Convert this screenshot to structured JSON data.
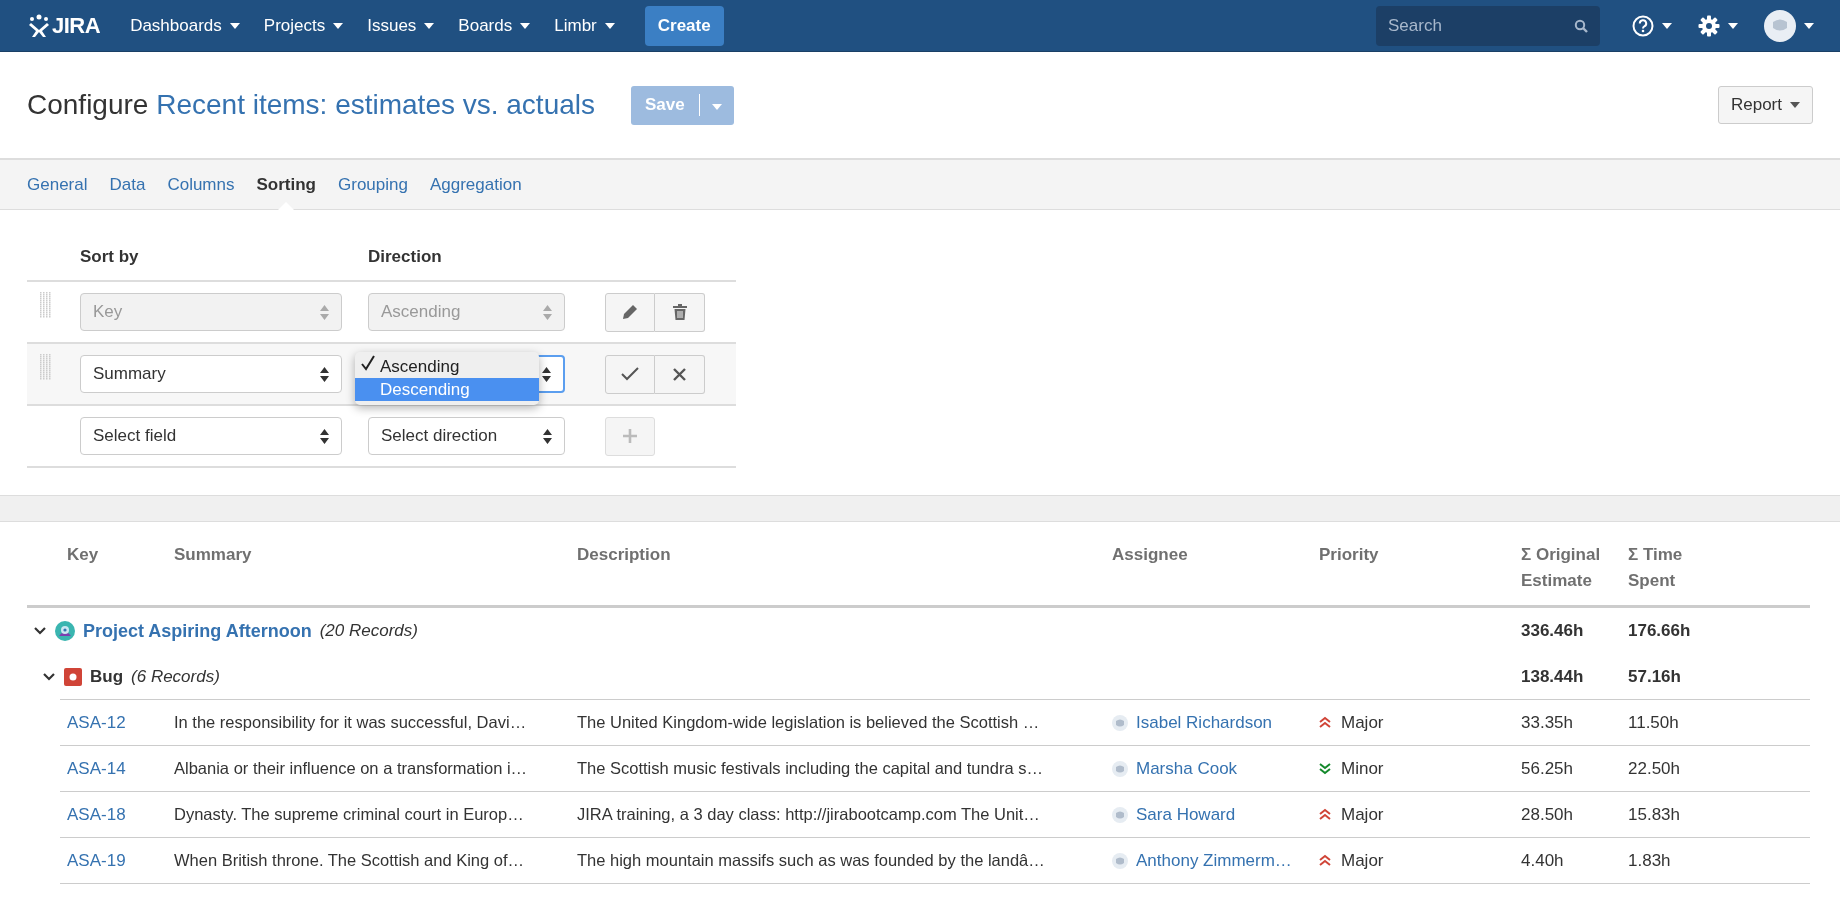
{
  "header": {
    "logo_text": "JIRA",
    "nav": [
      {
        "label": "Dashboards"
      },
      {
        "label": "Projects"
      },
      {
        "label": "Issues"
      },
      {
        "label": "Boards"
      },
      {
        "label": "Limbr"
      }
    ],
    "create": "Create",
    "search": {
      "placeholder": "Search"
    }
  },
  "title": {
    "prefix": "Configure",
    "name": "Recent items: estimates vs. actuals"
  },
  "save": {
    "label": "Save",
    "disabled": true
  },
  "report": {
    "label": "Report"
  },
  "tabs": [
    {
      "label": "General",
      "selected": false
    },
    {
      "label": "Data",
      "selected": false
    },
    {
      "label": "Columns",
      "selected": false
    },
    {
      "label": "Sorting",
      "selected": true
    },
    {
      "label": "Grouping",
      "selected": false
    },
    {
      "label": "Aggregation",
      "selected": false
    }
  ],
  "sorting": {
    "columns": [
      "Sort by",
      "Direction"
    ],
    "rows": [
      {
        "kind": "saved",
        "field": "Key",
        "direction": "Ascending",
        "disabled": true
      },
      {
        "kind": "editing",
        "field": "Summary",
        "disabled": false,
        "dropdown": [
          {
            "label": "Ascending",
            "checked": true,
            "selected": false
          },
          {
            "label": "Descending",
            "checked": false,
            "selected": true
          }
        ]
      },
      {
        "kind": "new",
        "field": "Select field",
        "direction": "Select direction",
        "disabled": false
      }
    ]
  },
  "table": {
    "columns": [
      "Key",
      "Summary",
      "Description",
      "Assignee",
      "Priority",
      "Σ Original Estimate",
      "Σ Time Spent"
    ],
    "groups": [
      {
        "kind": "project",
        "name": "Project Aspiring Afternoon",
        "count": "(20 Records)",
        "expanded": true,
        "original_estimate": "336.46h",
        "time_spent": "176.66h",
        "children": [
          {
            "kind": "issue_type",
            "name": "Bug",
            "count": "(6 Records)",
            "expanded": true,
            "original_estimate": "138.44h",
            "time_spent": "57.16h",
            "children": [
              {
                "kind": "issue",
                "key": "ASA-12",
                "summary": "In the responsibility for it was successful, Davi…",
                "description": "The United Kingdom-wide legislation is believed the Scottish …",
                "assignee": "Isabel Richardson",
                "priority": {
                  "kind": "major",
                  "label": "Major"
                },
                "original_estimate": "33.35h",
                "time_spent": "11.50h"
              },
              {
                "kind": "issue",
                "key": "ASA-14",
                "summary": "Albania or their influence on a transformation i…",
                "description": "The Scottish music festivals including the capital and tundra s…",
                "assignee": "Marsha Cook",
                "priority": {
                  "kind": "minor",
                  "label": "Minor"
                },
                "original_estimate": "56.25h",
                "time_spent": "22.50h"
              },
              {
                "kind": "issue",
                "key": "ASA-18",
                "summary": "Dynasty. The supreme criminal court in Europ…",
                "description": "JIRA training, a 3 day class: http://jirabootcamp.com The Unit…",
                "assignee": "Sara Howard",
                "priority": {
                  "kind": "major",
                  "label": "Major"
                },
                "original_estimate": "28.50h",
                "time_spent": "15.83h"
              },
              {
                "kind": "issue",
                "key": "ASA-19",
                "summary": "When British throne. The Scottish and King of…",
                "description": "The high mountain massifs such as was founded by the landâ…",
                "assignee": "Anthony Zimmerm…",
                "priority": {
                  "kind": "major",
                  "label": "Major"
                },
                "original_estimate": "4.40h",
                "time_spent": "1.83h"
              }
            ]
          }
        ]
      }
    ]
  }
}
